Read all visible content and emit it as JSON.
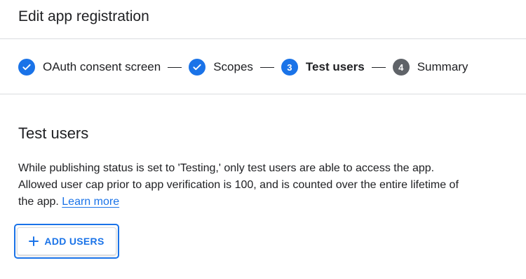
{
  "header": {
    "title": "Edit app registration"
  },
  "stepper": {
    "steps": [
      {
        "label": "OAuth consent screen",
        "state": "done",
        "number": ""
      },
      {
        "label": "Scopes",
        "state": "done",
        "number": ""
      },
      {
        "label": "Test users",
        "state": "current",
        "number": "3"
      },
      {
        "label": "Summary",
        "state": "pending",
        "number": "4"
      }
    ]
  },
  "main": {
    "title": "Test users",
    "description": "While publishing status is set to 'Testing,' only test users are able to access the app. Allowed user cap prior to app verification is 100, and is counted over the entire lifetime of the app.",
    "learn_more": "Learn more",
    "add_users_label": "ADD USERS"
  },
  "colors": {
    "accent": "#1a73e8",
    "pending": "#5f6368",
    "divider": "#dadce0",
    "text": "#202124"
  },
  "icons": {
    "done_step": "check-icon",
    "add": "plus-icon"
  }
}
